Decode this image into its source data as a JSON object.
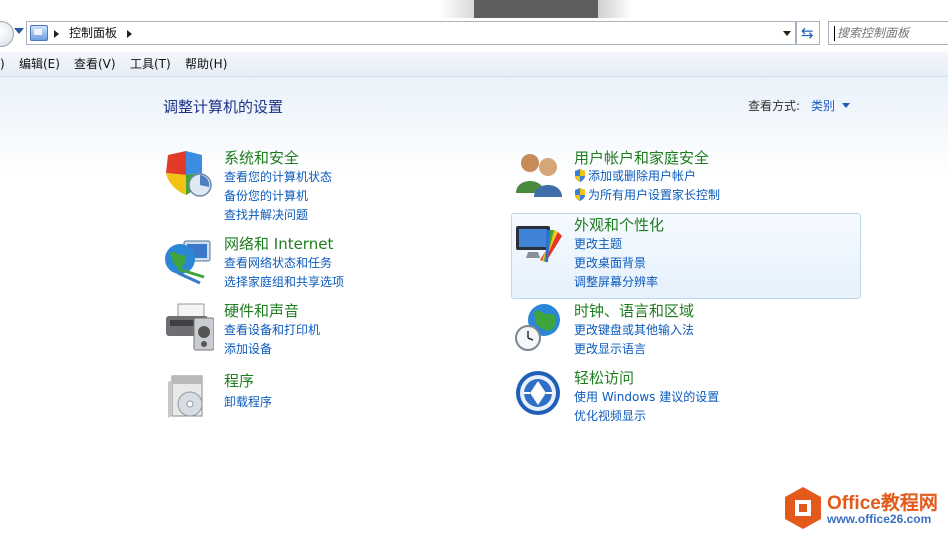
{
  "address_bar": {
    "breadcrumb": "控制面板",
    "search_placeholder": "搜索控制面板"
  },
  "menu": [
    {
      "label": ")"
    },
    {
      "label": "编辑(E)"
    },
    {
      "label": "查看(V)"
    },
    {
      "label": "工具(T)"
    },
    {
      "label": "帮助(H)"
    }
  ],
  "page": {
    "title": "调整计算机的设置",
    "view_by_label": "查看方式:",
    "view_by_value": "类别"
  },
  "categories": {
    "system_security": {
      "title": "系统和安全",
      "links": [
        "查看您的计算机状态",
        "备份您的计算机",
        "查找并解决问题"
      ]
    },
    "network": {
      "title": "网络和 Internet",
      "links": [
        "查看网络状态和任务",
        "选择家庭组和共享选项"
      ]
    },
    "hardware": {
      "title": "硬件和声音",
      "links": [
        "查看设备和打印机",
        "添加设备"
      ]
    },
    "programs": {
      "title": "程序",
      "links": [
        "卸载程序"
      ]
    },
    "user_accounts": {
      "title": "用户帐户和家庭安全",
      "links": [
        "添加或删除用户帐户",
        "为所有用户设置家长控制"
      ]
    },
    "appearance": {
      "title": "外观和个性化",
      "links": [
        "更改主题",
        "更改桌面背景",
        "调整屏幕分辨率"
      ]
    },
    "clock_region": {
      "title": "时钟、语言和区域",
      "links": [
        "更改键盘或其他输入法",
        "更改显示语言"
      ]
    },
    "ease_access": {
      "title": "轻松访问",
      "links": [
        "使用 Windows 建议的设置",
        "优化视频显示"
      ]
    }
  },
  "watermark": {
    "line1": "Office教程网",
    "line2": "www.office26.com"
  },
  "colors": {
    "category_title": "#1e7d1e",
    "link": "#0b5bbd",
    "page_title": "#1e3287",
    "watermark_orange": "#e45a1a"
  }
}
